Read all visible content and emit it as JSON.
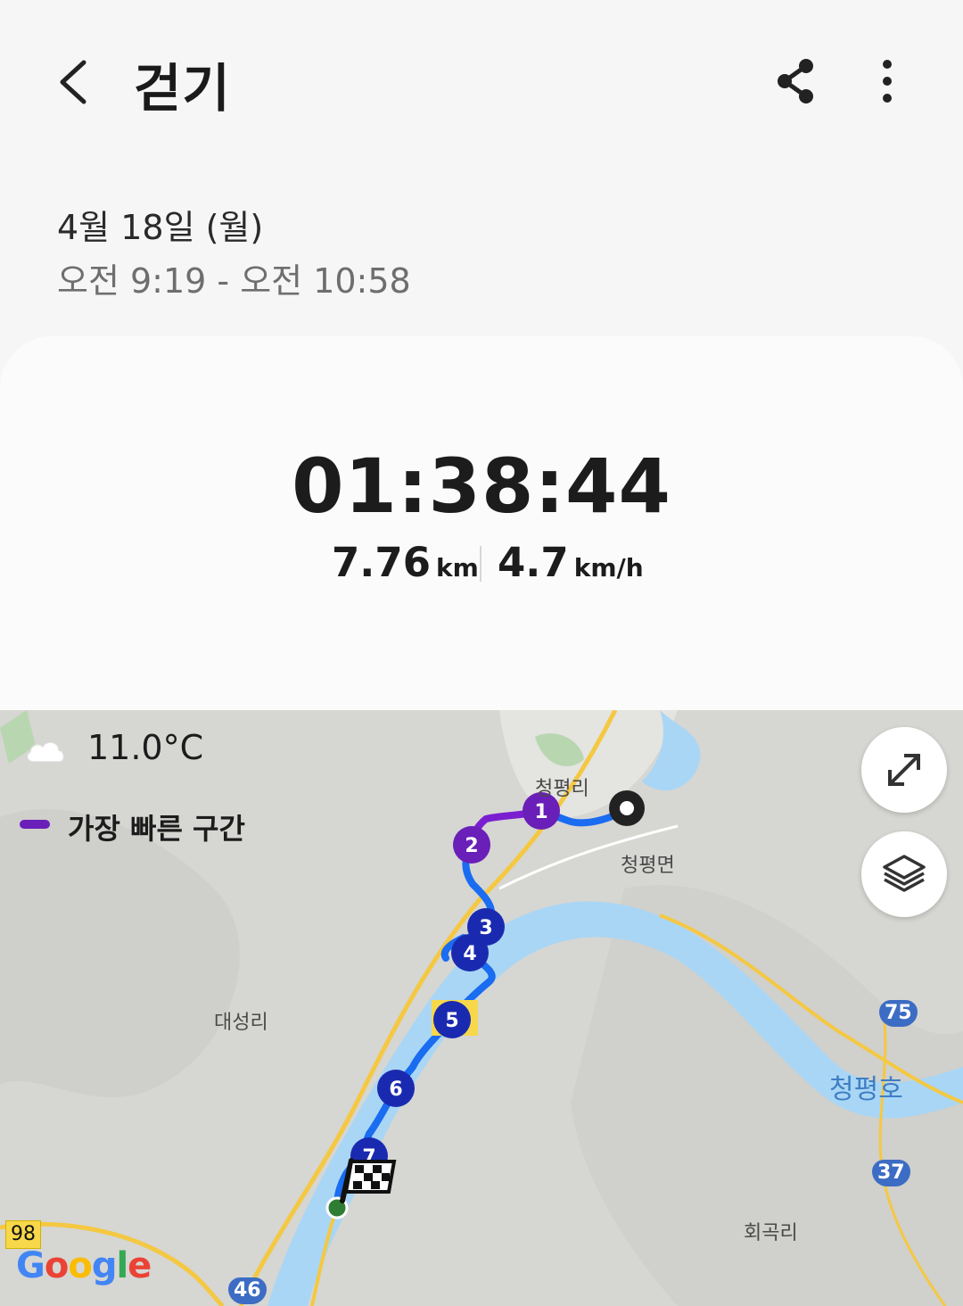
{
  "header": {
    "title": "걷기",
    "back_icon": "chevron-left-icon",
    "share_icon": "share-icon",
    "more_icon": "more-vertical-icon"
  },
  "session": {
    "date": "4월 18일 (월)",
    "time_range": "오전 9:19 - 오전 10:58"
  },
  "summary": {
    "duration": "01:38:44",
    "distance_value": "7.76",
    "distance_unit": "km",
    "speed_value": "4.7",
    "speed_unit": "km/h"
  },
  "map": {
    "weather": {
      "icon": "cloud-icon",
      "temperature": "11.0°C"
    },
    "legend": {
      "label": "가장 빠른 구간",
      "color": "#6a1fb8"
    },
    "buttons": {
      "expand_icon": "expand-icon",
      "layers_icon": "layers-icon"
    },
    "place_labels": {
      "cheongpyeong_ri": "청평리",
      "cheongpyeong_myeon": "청평면",
      "daeseong_ri": "대성리",
      "cheongpyeong_ho": "청평호",
      "hoegok_ri": "회곡리"
    },
    "road_badges": {
      "r75": "75",
      "r37": "37",
      "r46": "46",
      "r98": "98"
    },
    "split_markers": [
      "1",
      "2",
      "3",
      "4",
      "5",
      "6",
      "7"
    ],
    "route_color": "#1a6cf0",
    "fast_color": "#7a1fd0",
    "water_color": "#a9d6f5",
    "road_color": "#f5c842",
    "attribution": "Google"
  }
}
